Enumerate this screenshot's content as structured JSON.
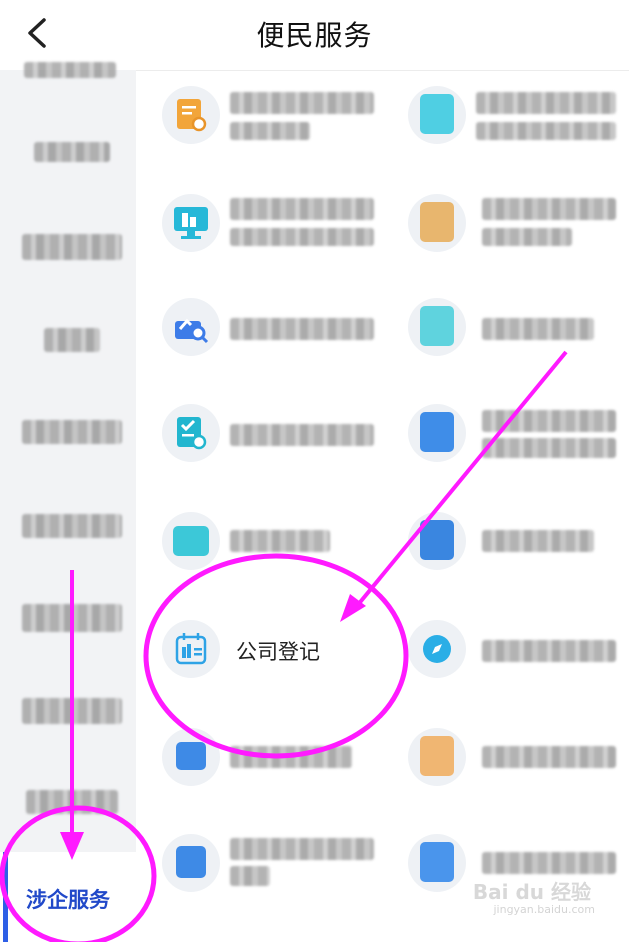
{
  "header": {
    "title": "便民服务",
    "back_icon": "chevron-left-icon"
  },
  "sidebar": {
    "active_label": "涉企服务",
    "active_color": "#2149c9",
    "accent": "#2e5fe6"
  },
  "grid": {
    "highlighted_item_label": "公司登记",
    "highlighted_icon": "calendar-building-icon",
    "compass_icon": "compass-icon"
  },
  "annotation": {
    "color": "#ff1aff"
  },
  "watermark": {
    "brand": "Bai du 经验",
    "url": "jingyan.baidu.com"
  }
}
